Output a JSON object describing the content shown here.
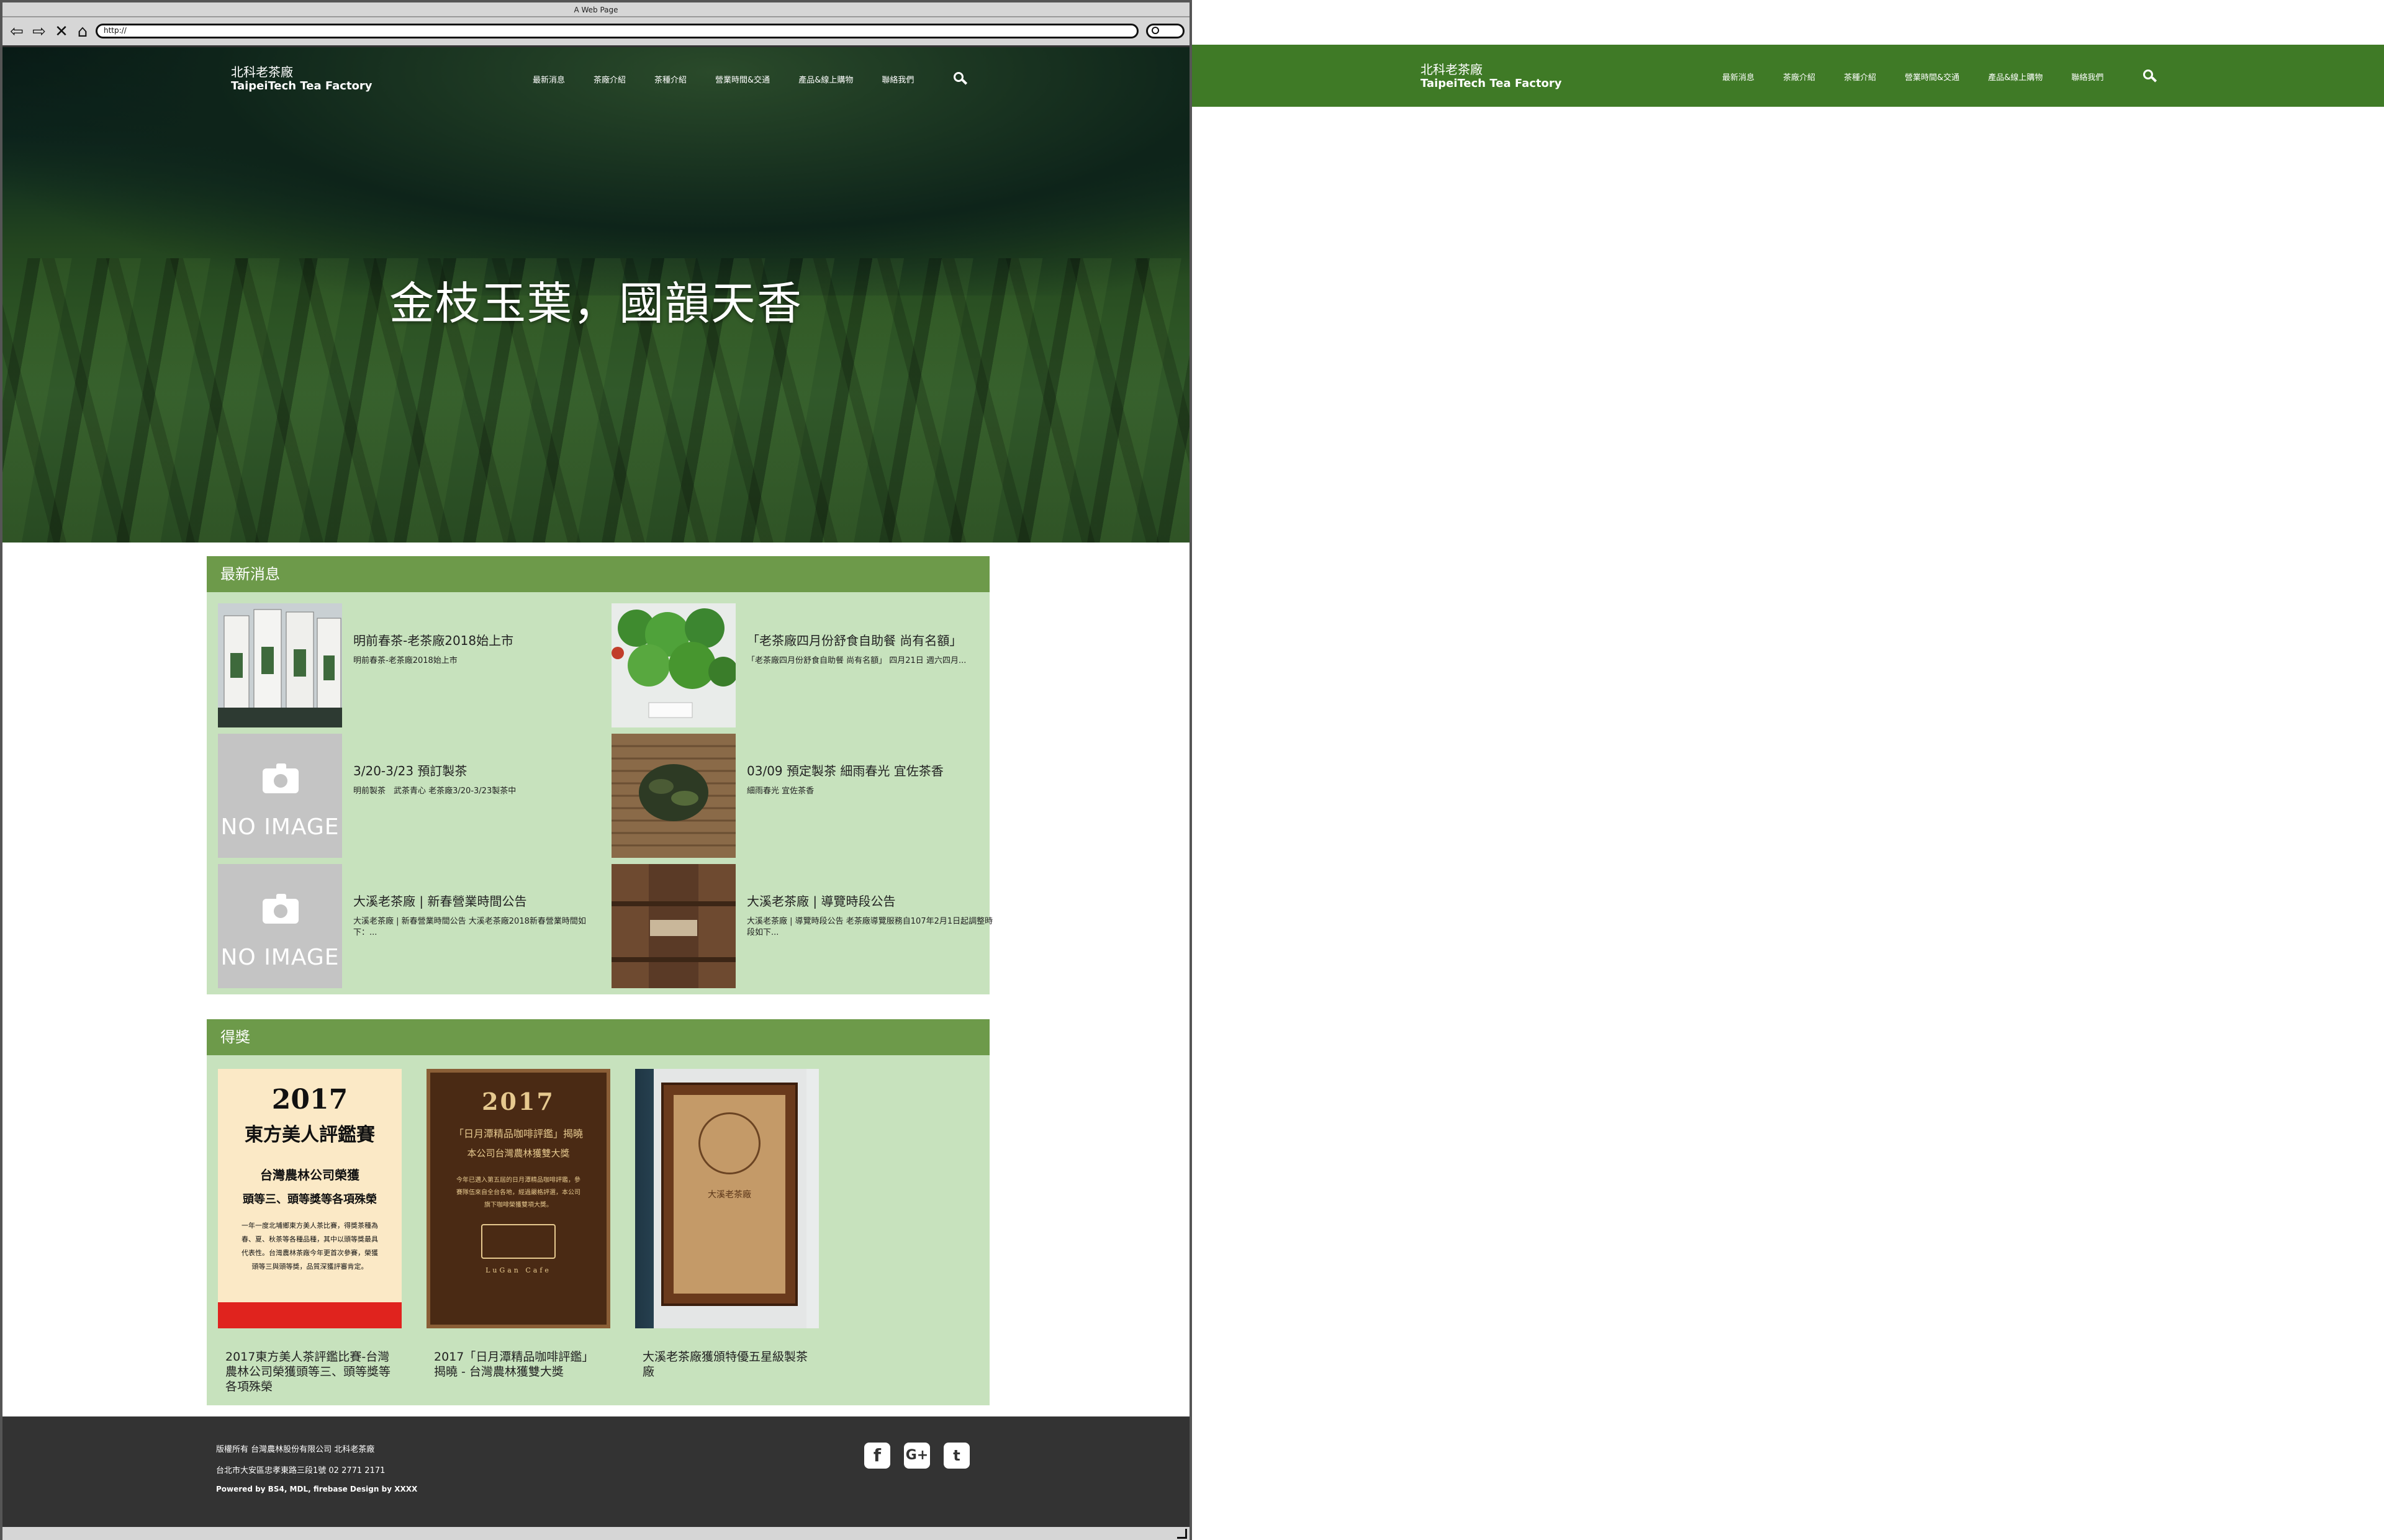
{
  "window": {
    "title": "A Web Page",
    "url": "http://"
  },
  "brand": {
    "name_zh": "北科老茶廠",
    "name_en": "TaipeiTech Tea Factory"
  },
  "nav": {
    "items": [
      "最新消息",
      "茶廠介紹",
      "茶種介紹",
      "營業時間&交通",
      "產品&線上購物",
      "聯絡我們"
    ],
    "search_icon": "search-icon"
  },
  "hero": {
    "title": "金枝玉葉，國韻天香"
  },
  "news": {
    "heading": "最新消息",
    "no_image_label": "NO IMAGE",
    "items": [
      {
        "title": "明前春茶-老茶廠2018始上市",
        "desc": "明前春茶-老茶廠2018始上市",
        "image": "tea-boxes"
      },
      {
        "title": "「老茶廠四月份舒食自助餐 尚有名額」",
        "desc": "「老茶廠四月份舒食自助餐 尚有名額」 四月21日 週六四月...",
        "image": "tea-leaves-dish"
      },
      {
        "title": "3/20-3/23 預訂製茶",
        "desc": "明前製茶　武茶青心 老茶廠3/20-3/23製茶中",
        "image": "none"
      },
      {
        "title": "03/09 預定製茶 細雨春光 宜佐茶香",
        "desc": "細雨春光 宜佐茶香",
        "image": "dried-tea-leaves"
      },
      {
        "title": "大溪老茶廠 | 新春營業時間公告",
        "desc": "大溪老茶廠 | 新春營業時間公告 大溪老茶廠2018新春營業時間如下：...",
        "image": "none"
      },
      {
        "title": "大溪老茶廠 | 導覽時段公告",
        "desc": "大溪老茶廠 | 導覽時段公告 老茶廠導覽服務自107年2月1日起調整時段如下...",
        "image": "wood-sign"
      }
    ]
  },
  "awards": {
    "heading": "得獎",
    "items": [
      {
        "caption": "2017東方美人茶評鑑比賽-台灣農林公司榮獲頭等三、頭等獎等各項殊榮",
        "poster": {
          "year": "2017",
          "title": "東方美人評鑑賽",
          "sub": "台灣農林公司榮獲",
          "sub2": "頭等三、頭等獎等各項殊榮",
          "body": "一年一度北埔鄉東方美人茶比賽，得獎茶種為春、夏、秋茶等各種品種，其中以頭等獎最具代表性。台灣農林茶廠今年更首次參賽，榮獲頭等三與頭等獎，品質深獲評審肯定。"
        }
      },
      {
        "caption": "2017「日月潭精品咖啡評鑑」揭曉 - 台灣農林獲雙大獎",
        "poster": {
          "year": "2017",
          "title": "「日月潭精品咖啡評鑑」揭曉",
          "sub": "本公司台灣農林獲雙大獎",
          "body": "今年已邁入第五屆的日月潭精品咖啡評鑑，參賽隊伍來自全台各地，經過嚴格評選，本公司旗下咖啡榮獲雙項大獎。",
          "brand": "LuGan Cafe"
        }
      },
      {
        "caption": "大溪老茶廠獲頒特優五星級製茶廠",
        "plaque": {
          "text": "大溪老茶廠"
        }
      }
    ]
  },
  "footer": {
    "copyright": "版權所有 台灣農林股份有限公司 北科老茶廠",
    "address": "台北市大安區忠孝東路三段1號 02 2771 2171",
    "powered": "Powered by BS4, MDL, firebase Design by XXXX",
    "social": [
      "facebook-icon",
      "google-plus-icon",
      "twitter-icon"
    ]
  },
  "colors": {
    "header_green": "#3f7a26",
    "panel_head": "#6d9a4a",
    "panel_bg": "#c7e2bd",
    "footer": "#333333"
  }
}
